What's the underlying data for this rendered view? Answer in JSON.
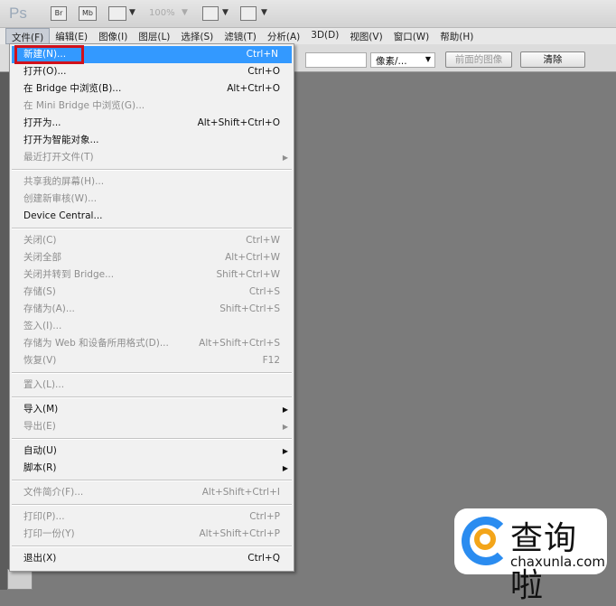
{
  "app": {
    "logo": "Ps",
    "br": "Br",
    "mb": "Mb",
    "zoom": "100%"
  },
  "menubar": [
    "文件(F)",
    "编辑(E)",
    "图像(I)",
    "图层(L)",
    "选择(S)",
    "滤镜(T)",
    "分析(A)",
    "3D(D)",
    "视图(V)",
    "窗口(W)",
    "帮助(H)"
  ],
  "options": {
    "unit_select": "像素/...",
    "front_image_button": "前面的图像",
    "clear_button": "清除"
  },
  "file_menu": [
    {
      "label": "新建(N)...",
      "shortcut": "Ctrl+N",
      "highlighted": true
    },
    {
      "label": "打开(O)...",
      "shortcut": "Ctrl+O"
    },
    {
      "label": "在 Bridge 中浏览(B)...",
      "shortcut": "Alt+Ctrl+O"
    },
    {
      "label": "在 Mini Bridge 中浏览(G)...",
      "disabled": true
    },
    {
      "label": "打开为...",
      "shortcut": "Alt+Shift+Ctrl+O"
    },
    {
      "label": "打开为智能对象..."
    },
    {
      "label": "最近打开文件(T)",
      "disabled": true,
      "submenu": true
    },
    {
      "sep": true
    },
    {
      "label": "共享我的屏幕(H)...",
      "disabled": true
    },
    {
      "label": "创建新审核(W)...",
      "disabled": true
    },
    {
      "label": "Device Central..."
    },
    {
      "sep": true
    },
    {
      "label": "关闭(C)",
      "shortcut": "Ctrl+W",
      "disabled": true
    },
    {
      "label": "关闭全部",
      "shortcut": "Alt+Ctrl+W",
      "disabled": true
    },
    {
      "label": "关闭并转到 Bridge...",
      "shortcut": "Shift+Ctrl+W",
      "disabled": true
    },
    {
      "label": "存储(S)",
      "shortcut": "Ctrl+S",
      "disabled": true
    },
    {
      "label": "存储为(A)...",
      "shortcut": "Shift+Ctrl+S",
      "disabled": true
    },
    {
      "label": "签入(I)...",
      "disabled": true
    },
    {
      "label": "存储为 Web 和设备所用格式(D)...",
      "shortcut": "Alt+Shift+Ctrl+S",
      "disabled": true
    },
    {
      "label": "恢复(V)",
      "shortcut": "F12",
      "disabled": true
    },
    {
      "sep": true
    },
    {
      "label": "置入(L)...",
      "disabled": true
    },
    {
      "sep": true
    },
    {
      "label": "导入(M)",
      "submenu": true
    },
    {
      "label": "导出(E)",
      "disabled": true,
      "submenu": true
    },
    {
      "sep": true
    },
    {
      "label": "自动(U)",
      "submenu": true
    },
    {
      "label": "脚本(R)",
      "submenu": true
    },
    {
      "sep": true
    },
    {
      "label": "文件简介(F)...",
      "shortcut": "Alt+Shift+Ctrl+I",
      "disabled": true
    },
    {
      "sep": true
    },
    {
      "label": "打印(P)...",
      "shortcut": "Ctrl+P",
      "disabled": true
    },
    {
      "label": "打印一份(Y)",
      "shortcut": "Alt+Shift+Ctrl+P",
      "disabled": true
    },
    {
      "sep": true
    },
    {
      "label": "退出(X)",
      "shortcut": "Ctrl+Q"
    }
  ],
  "watermark": {
    "title": "查询啦",
    "url": "chaxunla.com"
  },
  "colors": {
    "highlight": "#3399ff",
    "annotation_box": "#d0101a"
  }
}
